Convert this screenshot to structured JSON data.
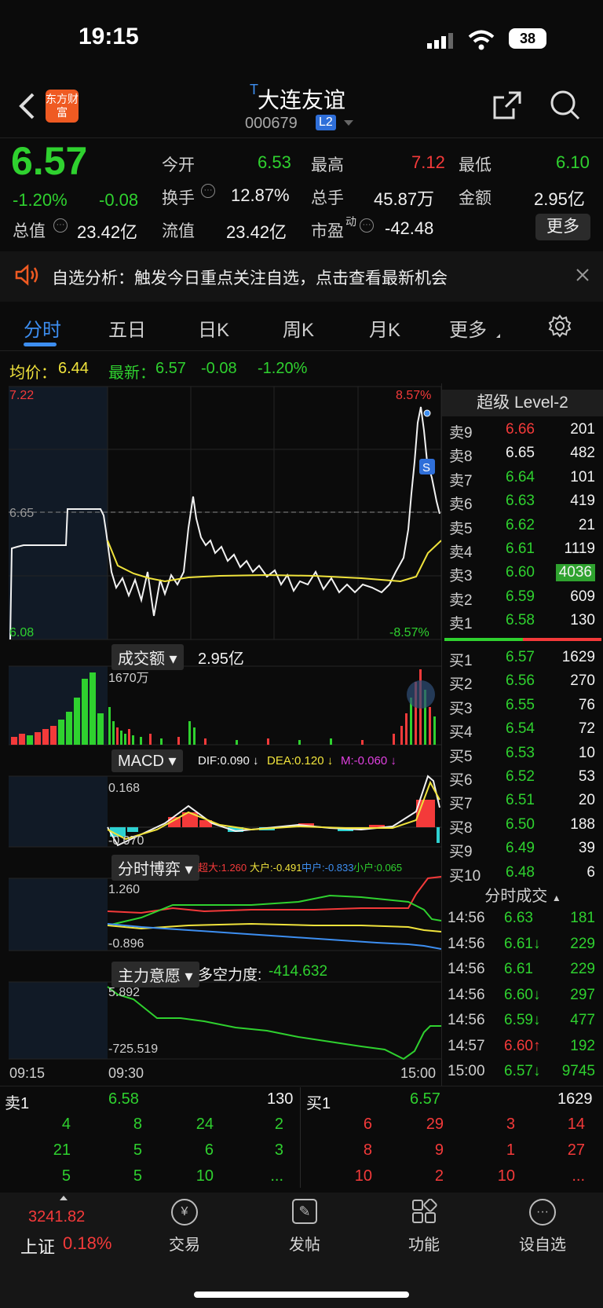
{
  "status": {
    "time": "19:15",
    "battery": "38"
  },
  "header": {
    "logo": "东方财富",
    "title": "大连友谊",
    "code": "000679",
    "level": "L2",
    "badge": "T"
  },
  "quote": {
    "price": "6.57",
    "change_pct": "-1.20%",
    "change": "-0.08",
    "open_label": "今开",
    "open": "6.53",
    "high_label": "最高",
    "high": "7.12",
    "low_label": "最低",
    "low": "6.10",
    "turnover_label": "换手",
    "turnover": "12.87%",
    "volume_label": "总手",
    "volume": "45.87万",
    "amount_label": "金额",
    "amount": "2.95亿",
    "mcap_label": "总值",
    "mcap": "23.42亿",
    "float_label": "流值",
    "float": "23.42亿",
    "pe_label": "市盈",
    "pe_sup": "动",
    "pe": "-42.48",
    "more": "更多"
  },
  "banner": {
    "text": "自选分析：触发今日重点关注自选，点击查看最新机会"
  },
  "tabs": [
    "分时",
    "五日",
    "日K",
    "周K",
    "月K",
    "更多"
  ],
  "legend": {
    "avg_label": "均价：",
    "avg": "6.44",
    "latest_label": "最新：",
    "latest": "6.57",
    "chg": "-0.08",
    "pct": "-1.20%"
  },
  "intraday": {
    "y_top": "7.22",
    "y_ref": "6.65",
    "y_bot": "6.08",
    "pct_top": "8.57%",
    "pct_bot": "-8.57%",
    "marker": "S"
  },
  "volume_panel": {
    "label": "成交额",
    "total": "2.95亿",
    "max_label": "1670万"
  },
  "macd_panel": {
    "label": "MACD",
    "dif": "DIF:0.090 ↓",
    "dea": "DEA:0.120 ↓",
    "m": "M:-0.060 ↓",
    "max": "0.168",
    "min": "-0.070"
  },
  "game_panel": {
    "label": "分时博弈",
    "super": "超大:1.260",
    "large": "大户:-0.491",
    "mid": "中户:-0.833",
    "small": "小户:0.065",
    "max": "1.260",
    "min": "-0.896"
  },
  "intent_panel": {
    "label": "主力意愿",
    "force_label": "多空力度:",
    "force": "-414.632",
    "max": "5.892",
    "min": "-725.519"
  },
  "x_axis": {
    "t0": "09:15",
    "t1": "09:30",
    "t2": "15:00"
  },
  "level2": {
    "title": "超级 Level-2",
    "asks": [
      {
        "label": "卖9",
        "price": "6.66",
        "vol": "201"
      },
      {
        "label": "卖8",
        "price": "6.65",
        "vol": "482"
      },
      {
        "label": "卖7",
        "price": "6.64",
        "vol": "101"
      },
      {
        "label": "卖6",
        "price": "6.63",
        "vol": "419"
      },
      {
        "label": "卖5",
        "price": "6.62",
        "vol": "21"
      },
      {
        "label": "卖4",
        "price": "6.61",
        "vol": "1119"
      },
      {
        "label": "卖3",
        "price": "6.60",
        "vol": "4036"
      },
      {
        "label": "卖2",
        "price": "6.59",
        "vol": "609"
      },
      {
        "label": "卖1",
        "price": "6.58",
        "vol": "130"
      }
    ],
    "bids": [
      {
        "label": "买1",
        "price": "6.57",
        "vol": "1629"
      },
      {
        "label": "买2",
        "price": "6.56",
        "vol": "270"
      },
      {
        "label": "买3",
        "price": "6.55",
        "vol": "76"
      },
      {
        "label": "买4",
        "price": "6.54",
        "vol": "72"
      },
      {
        "label": "买5",
        "price": "6.53",
        "vol": "10"
      },
      {
        "label": "买6",
        "price": "6.52",
        "vol": "53"
      },
      {
        "label": "买7",
        "price": "6.51",
        "vol": "20"
      },
      {
        "label": "买8",
        "price": "6.50",
        "vol": "188"
      },
      {
        "label": "买9",
        "price": "6.49",
        "vol": "39"
      },
      {
        "label": "买10",
        "price": "6.48",
        "vol": "6"
      }
    ],
    "ticks_title": "分时成交",
    "ticks": [
      {
        "time": "14:56",
        "price": "6.63",
        "vol": "181"
      },
      {
        "time": "14:56",
        "price": "6.61↓",
        "vol": "229"
      },
      {
        "time": "14:56",
        "price": "6.61",
        "vol": "229"
      },
      {
        "time": "14:56",
        "price": "6.60↓",
        "vol": "297"
      },
      {
        "time": "14:56",
        "price": "6.59↓",
        "vol": "477"
      },
      {
        "time": "14:57",
        "price": "6.60↑",
        "vol": "192"
      },
      {
        "time": "15:00",
        "price": "6.57↓",
        "vol": "9745"
      }
    ]
  },
  "queue": {
    "sell_label": "卖1",
    "sell_price": "6.58",
    "sell_vol": "130",
    "buy_label": "买1",
    "buy_price": "6.57",
    "buy_vol": "1629",
    "sell_rows": [
      [
        "4",
        "8",
        "24",
        "2"
      ],
      [
        "21",
        "5",
        "6",
        "3"
      ],
      [
        "5",
        "5",
        "10",
        "..."
      ]
    ],
    "buy_rows": [
      [
        "6",
        "29",
        "3",
        "14"
      ],
      [
        "8",
        "9",
        "1",
        "27"
      ],
      [
        "10",
        "2",
        "10",
        "..."
      ]
    ]
  },
  "nav": {
    "index_value": "3241.82",
    "index_name": "上证",
    "index_pct": "0.18%",
    "items": [
      "交易",
      "发帖",
      "功能",
      "设自选"
    ]
  },
  "colors": {
    "up": "#f43a3a",
    "down": "#2fd12f",
    "accent": "#3d8ef0",
    "avg_line": "#f0e33c"
  }
}
